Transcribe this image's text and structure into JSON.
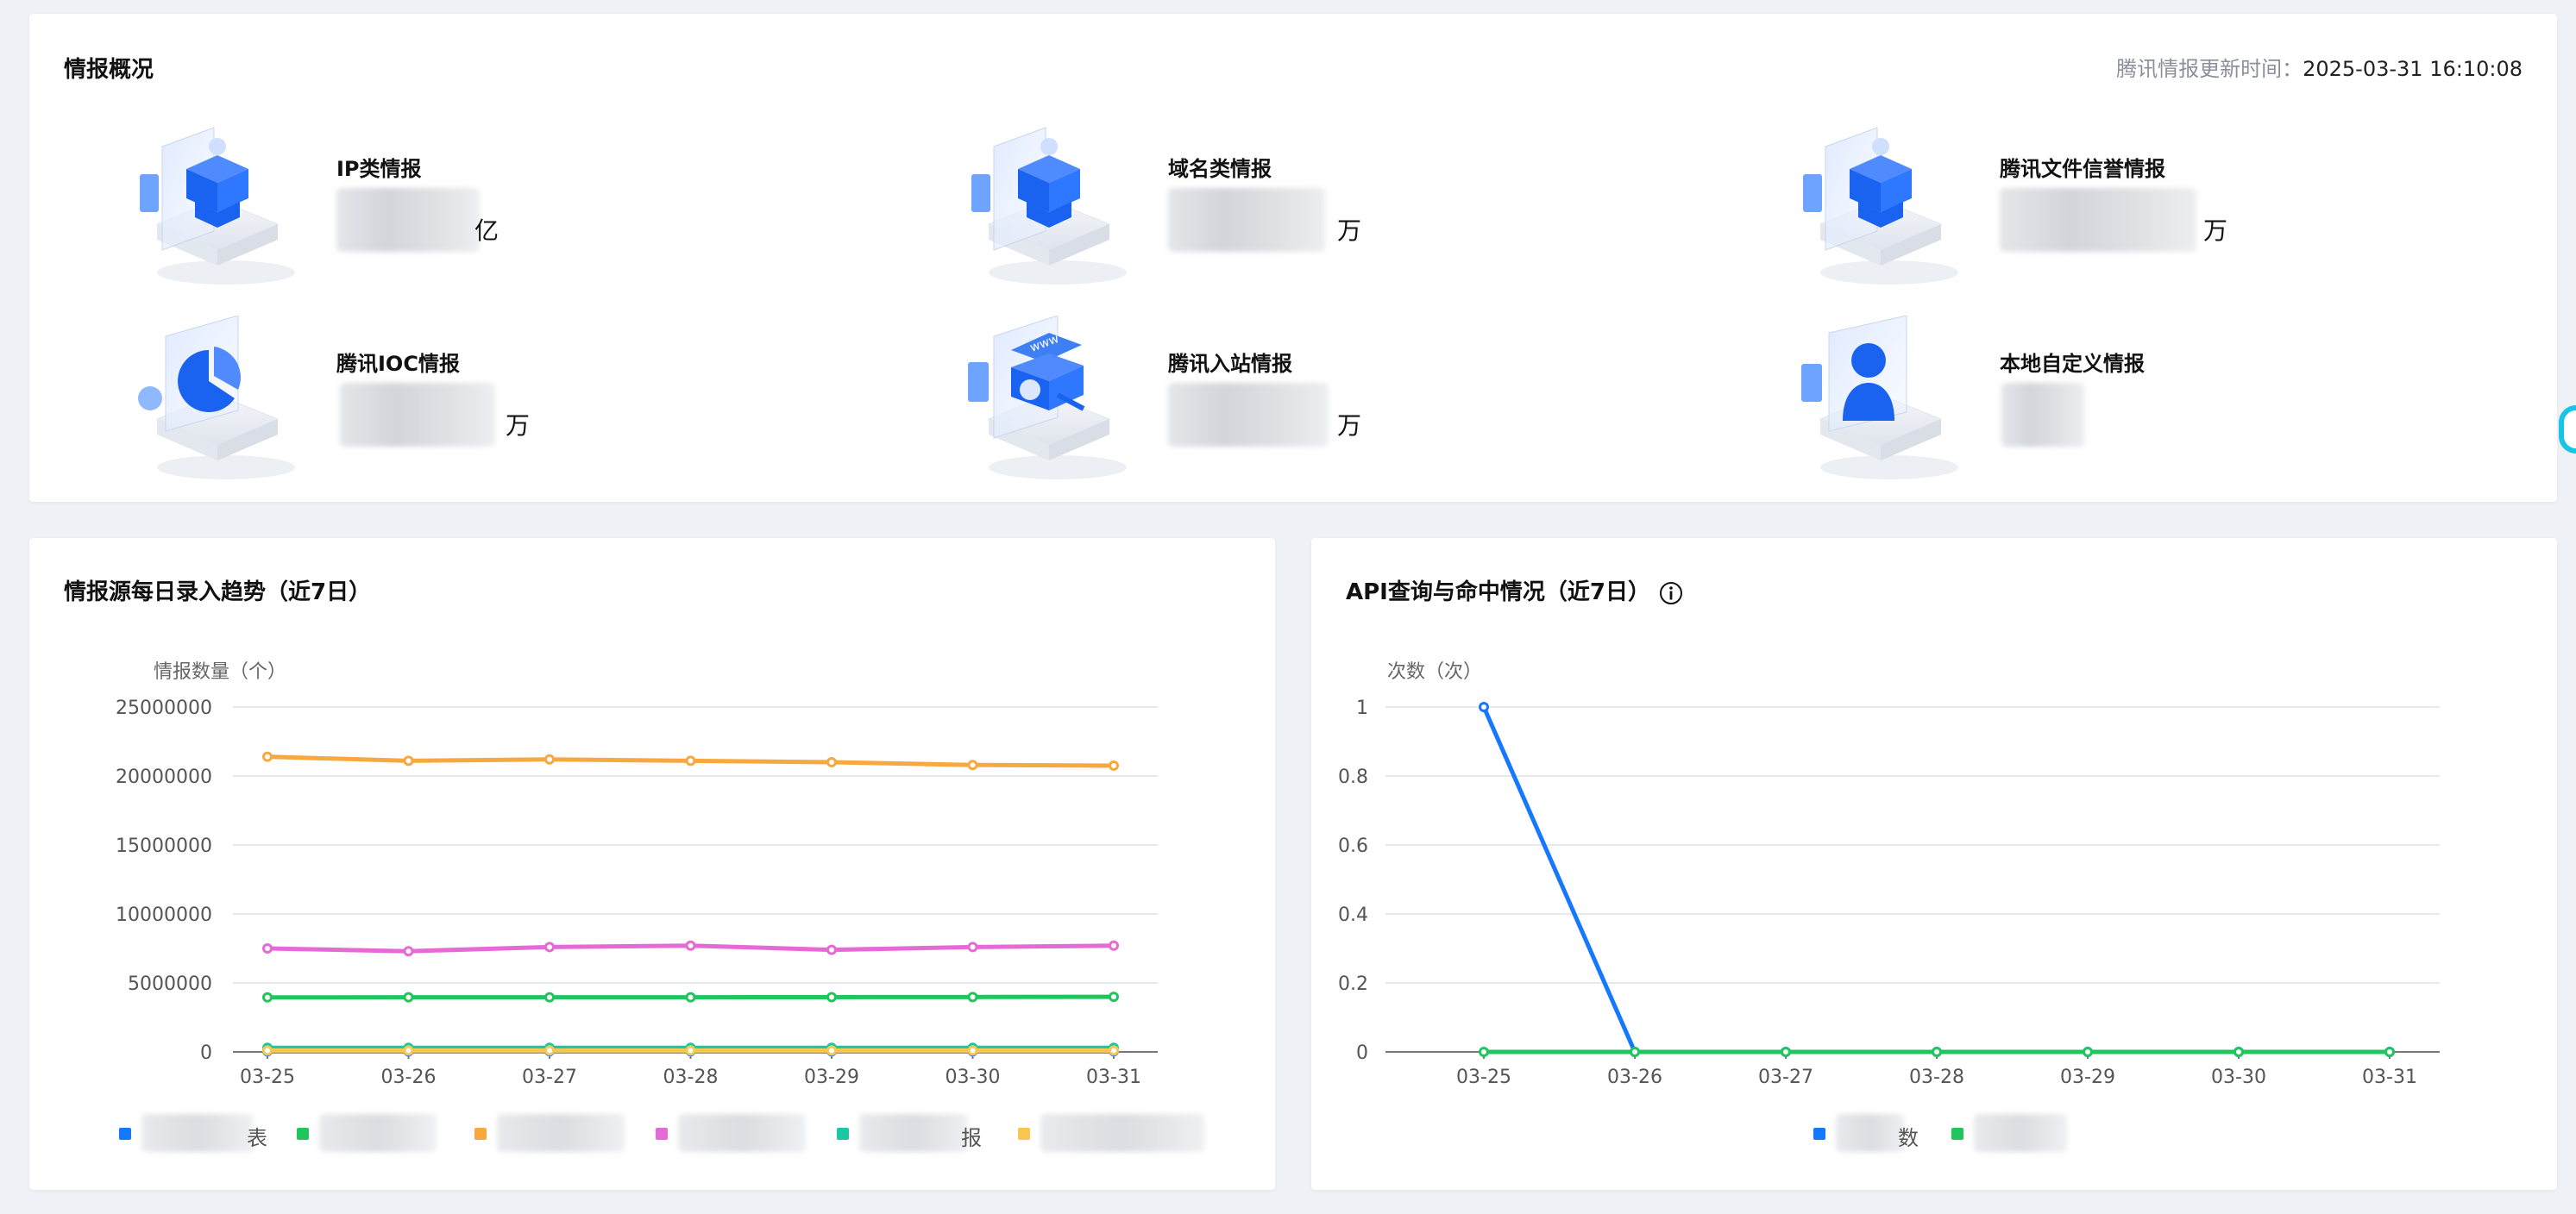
{
  "overview": {
    "title": "情报概况",
    "update_label": "腾讯情报更新时间：",
    "update_time": "2025-03-31 16:10:08",
    "tiles": [
      {
        "label": "IP类情报",
        "unit": "亿",
        "icon": "cube-stack-icon"
      },
      {
        "label": "域名类情报",
        "unit": "万",
        "icon": "cube-stack-icon"
      },
      {
        "label": "腾讯文件信誉情报",
        "unit": "万",
        "icon": "cube-stack-icon"
      },
      {
        "label": "腾讯IOC情报",
        "unit": "万",
        "icon": "pie-shield-icon"
      },
      {
        "label": "腾讯入站情报",
        "unit": "万",
        "icon": "www-gear-icon"
      },
      {
        "label": "本地自定义情报",
        "unit": "",
        "icon": "user-card-icon"
      }
    ]
  },
  "trend_chart": {
    "title": "情报源每日录入趋势（近7日）",
    "chart_data": {
      "type": "line",
      "title": "情报源每日录入趋势（近7日）",
      "ylabel": "情报数量（个）",
      "xlabel": "",
      "ylim": [
        0,
        25000000
      ],
      "yticks": [
        "25000000",
        "20000000",
        "15000000",
        "10000000",
        "5000000",
        "0"
      ],
      "categories": [
        "03-25",
        "03-26",
        "03-27",
        "03-28",
        "03-29",
        "03-30",
        "03-31"
      ],
      "grid": true,
      "legend_position": "bottom",
      "series": [
        {
          "color": "#1677ff",
          "values": [
            50000,
            50000,
            50000,
            50000,
            50000,
            50000,
            50000
          ]
        },
        {
          "color": "#21c55d",
          "values": [
            3950000,
            3960000,
            3960000,
            3960000,
            3970000,
            3980000,
            3990000
          ]
        },
        {
          "color": "#f7a940",
          "values": [
            21400000,
            21100000,
            21200000,
            21100000,
            21000000,
            20800000,
            20750000
          ]
        },
        {
          "color": "#e66ad6",
          "values": [
            7500000,
            7300000,
            7600000,
            7700000,
            7400000,
            7600000,
            7700000
          ]
        },
        {
          "color": "#19c7a1",
          "values": [
            300000,
            300000,
            300000,
            300000,
            300000,
            300000,
            300000
          ]
        },
        {
          "color": "#f9c74f",
          "values": [
            100000,
            100000,
            100000,
            100000,
            100000,
            100000,
            100000
          ]
        }
      ]
    },
    "legend": [
      {
        "color": "#1677ff",
        "suffix": "表"
      },
      {
        "color": "#21c55d",
        "suffix": ""
      },
      {
        "color": "#f7a940",
        "suffix": ""
      },
      {
        "color": "#e66ad6",
        "suffix": ""
      },
      {
        "color": "#19c7a1",
        "suffix": "报"
      },
      {
        "color": "#f9c74f",
        "suffix": ""
      }
    ]
  },
  "api_chart": {
    "title": "API查询与命中情况（近7日）",
    "info_icon": "info-circle-icon",
    "chart_data": {
      "type": "line",
      "title": "API查询与命中情况（近7日）",
      "ylabel": "次数（次）",
      "xlabel": "",
      "ylim": [
        0,
        1
      ],
      "yticks": [
        "1",
        "0.8",
        "0.6",
        "0.4",
        "0.2",
        "0"
      ],
      "categories": [
        "03-25",
        "03-26",
        "03-27",
        "03-28",
        "03-29",
        "03-30",
        "03-31"
      ],
      "grid": true,
      "legend_position": "bottom",
      "series": [
        {
          "color": "#1677ff",
          "values": [
            1,
            0,
            0,
            0,
            0,
            0,
            0
          ]
        },
        {
          "color": "#21c55d",
          "values": [
            0,
            0,
            0,
            0,
            0,
            0,
            0
          ]
        }
      ]
    },
    "legend": [
      {
        "color": "#1677ff",
        "suffix": "数"
      },
      {
        "color": "#21c55d",
        "suffix": ""
      }
    ]
  }
}
